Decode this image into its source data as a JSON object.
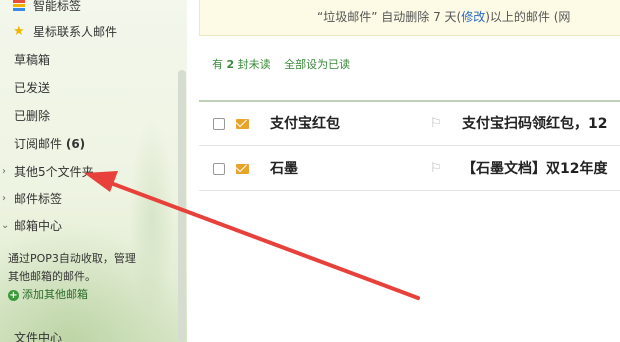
{
  "sidebar": {
    "items": [
      {
        "label": "智能标签",
        "icon": "tag-icon"
      },
      {
        "label": "星标联系人邮件",
        "icon": "star-icon"
      },
      {
        "label": "草稿箱"
      },
      {
        "label": "已发送"
      },
      {
        "label": "已删除"
      },
      {
        "label": "订阅邮件",
        "count": "(6)"
      },
      {
        "label": "其他5个文件夹"
      },
      {
        "label": "邮件标签"
      },
      {
        "label": "邮箱中心"
      }
    ],
    "pop": {
      "line1": "通过POP3自动收取，管理",
      "line2": "其他邮箱的邮件。",
      "add_label": "添加其他邮箱"
    },
    "bottom_item": "文件中心"
  },
  "banner": {
    "text_before": "“垃圾邮件” 自动删除 7 天(",
    "link": "修改",
    "text_after": ")以上的邮件 (网"
  },
  "unread": {
    "prefix": "有",
    "count": "2",
    "suffix": "封未读",
    "mark_all": "全部设为已读"
  },
  "emails": [
    {
      "sender": "支付宝红包",
      "subject": "支付宝扫码领红包，12"
    },
    {
      "sender": "石墨",
      "subject": "【石墨文档】双12年度"
    }
  ],
  "colors": {
    "accent_green": "#3a8a3a",
    "arrow_red": "#e8403a",
    "link_blue": "#2a6ac4"
  }
}
